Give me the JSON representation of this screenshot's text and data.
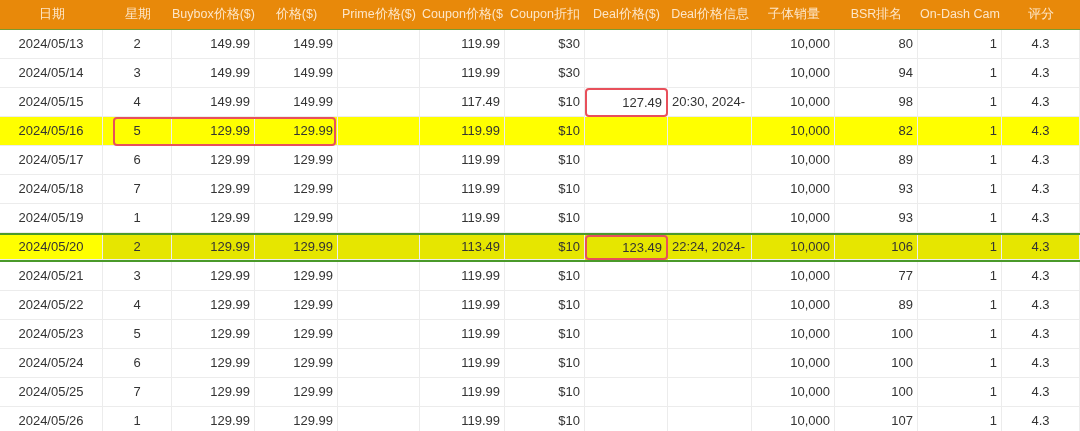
{
  "columns": [
    "日期",
    "星期",
    "Buybox价格($)",
    "价格($)",
    "Prime价格($)",
    "Coupon价格($",
    "Coupon折扣",
    "Deal价格($)",
    "Deal价格信息",
    "子体销量",
    "BSR排名",
    "On-Dash Cam",
    "评分"
  ],
  "rows": [
    {
      "highlighted": false,
      "framed": false,
      "price_outlined": false,
      "deal_outlined": false,
      "cells": [
        "2024/05/13",
        "2",
        "149.99",
        "149.99",
        null,
        "119.99",
        "$30",
        null,
        null,
        "10,000",
        "80",
        "1",
        "4.3"
      ]
    },
    {
      "highlighted": false,
      "framed": false,
      "price_outlined": false,
      "deal_outlined": false,
      "cells": [
        "2024/05/14",
        "3",
        "149.99",
        "149.99",
        null,
        "119.99",
        "$30",
        null,
        null,
        "10,000",
        "94",
        "1",
        "4.3"
      ]
    },
    {
      "highlighted": false,
      "framed": false,
      "price_outlined": false,
      "deal_outlined": true,
      "cells": [
        "2024/05/15",
        "4",
        "149.99",
        "149.99",
        null,
        "117.49",
        "$10",
        "127.49",
        "20:30, 2024-",
        "10,000",
        "98",
        "1",
        "4.3"
      ]
    },
    {
      "highlighted": true,
      "framed": false,
      "price_outlined": true,
      "deal_outlined": false,
      "cells": [
        "2024/05/16",
        "5",
        "129.99",
        "129.99",
        null,
        "119.99",
        "$10",
        null,
        null,
        "10,000",
        "82",
        "1",
        "4.3"
      ]
    },
    {
      "highlighted": false,
      "framed": false,
      "price_outlined": false,
      "deal_outlined": false,
      "cells": [
        "2024/05/17",
        "6",
        "129.99",
        "129.99",
        null,
        "119.99",
        "$10",
        null,
        null,
        "10,000",
        "89",
        "1",
        "4.3"
      ]
    },
    {
      "highlighted": false,
      "framed": false,
      "price_outlined": false,
      "deal_outlined": false,
      "cells": [
        "2024/05/18",
        "7",
        "129.99",
        "129.99",
        null,
        "119.99",
        "$10",
        null,
        null,
        "10,000",
        "93",
        "1",
        "4.3"
      ]
    },
    {
      "highlighted": false,
      "framed": false,
      "price_outlined": false,
      "deal_outlined": false,
      "cells": [
        "2024/05/19",
        "1",
        "129.99",
        "129.99",
        null,
        "119.99",
        "$10",
        null,
        null,
        "10,000",
        "93",
        "1",
        "4.3"
      ]
    },
    {
      "highlighted": true,
      "framed": true,
      "price_outlined": false,
      "deal_outlined": true,
      "cells": [
        "2024/05/20",
        "2",
        "129.99",
        "129.99",
        null,
        "113.49",
        "$10",
        "123.49",
        "22:24, 2024-",
        "10,000",
        "106",
        "1",
        "4.3"
      ]
    },
    {
      "highlighted": false,
      "framed": false,
      "price_outlined": false,
      "deal_outlined": false,
      "cells": [
        "2024/05/21",
        "3",
        "129.99",
        "129.99",
        null,
        "119.99",
        "$10",
        null,
        null,
        "10,000",
        "77",
        "1",
        "4.3"
      ]
    },
    {
      "highlighted": false,
      "framed": false,
      "price_outlined": false,
      "deal_outlined": false,
      "cells": [
        "2024/05/22",
        "4",
        "129.99",
        "129.99",
        null,
        "119.99",
        "$10",
        null,
        null,
        "10,000",
        "89",
        "1",
        "4.3"
      ]
    },
    {
      "highlighted": false,
      "framed": false,
      "price_outlined": false,
      "deal_outlined": false,
      "cells": [
        "2024/05/23",
        "5",
        "129.99",
        "129.99",
        null,
        "119.99",
        "$10",
        null,
        null,
        "10,000",
        "100",
        "1",
        "4.3"
      ]
    },
    {
      "highlighted": false,
      "framed": false,
      "price_outlined": false,
      "deal_outlined": false,
      "cells": [
        "2024/05/24",
        "6",
        "129.99",
        "129.99",
        null,
        "119.99",
        "$10",
        null,
        null,
        "10,000",
        "100",
        "1",
        "4.3"
      ]
    },
    {
      "highlighted": false,
      "framed": false,
      "price_outlined": false,
      "deal_outlined": false,
      "cells": [
        "2024/05/25",
        "7",
        "129.99",
        "129.99",
        null,
        "119.99",
        "$10",
        null,
        null,
        "10,000",
        "100",
        "1",
        "4.3"
      ]
    },
    {
      "highlighted": false,
      "framed": false,
      "price_outlined": false,
      "deal_outlined": false,
      "cells": [
        "2024/05/26",
        "1",
        "129.99",
        "129.99",
        null,
        "119.99",
        "$10",
        null,
        null,
        "10,000",
        "107",
        "1",
        "4.3"
      ]
    }
  ]
}
